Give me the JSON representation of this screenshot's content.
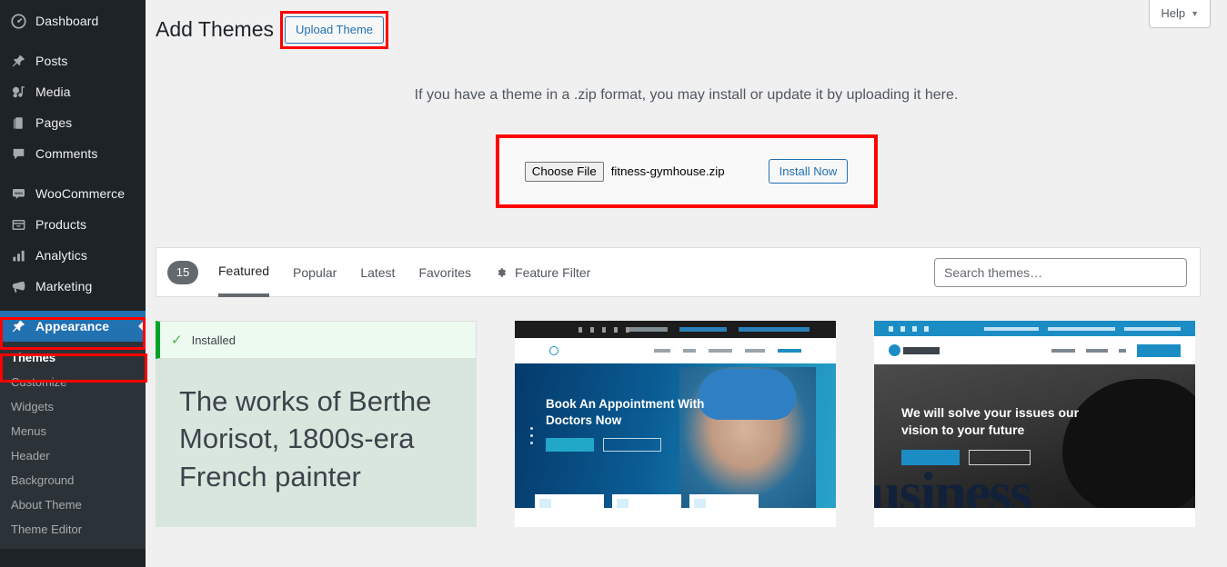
{
  "sidebar": {
    "items": [
      {
        "label": "Dashboard",
        "icon": "dashboard-icon"
      },
      {
        "label": "Posts",
        "icon": "pin-icon"
      },
      {
        "label": "Media",
        "icon": "media-icon"
      },
      {
        "label": "Pages",
        "icon": "pages-icon"
      },
      {
        "label": "Comments",
        "icon": "comments-icon"
      },
      {
        "label": "WooCommerce",
        "icon": "woocommerce-icon"
      },
      {
        "label": "Products",
        "icon": "products-icon"
      },
      {
        "label": "Analytics",
        "icon": "analytics-icon"
      },
      {
        "label": "Marketing",
        "icon": "megaphone-icon"
      },
      {
        "label": "Appearance",
        "icon": "appearance-icon"
      }
    ],
    "appearance_submenu": [
      "Themes",
      "Customize",
      "Widgets",
      "Menus",
      "Header",
      "Background",
      "About Theme",
      "Theme Editor"
    ],
    "current_item": "Appearance",
    "current_subitem": "Themes",
    "highlight_color": "#2271b1",
    "annotation_color": "#ff0000"
  },
  "header": {
    "help_label": "Help",
    "help_caret": "▼",
    "page_title": "Add Themes",
    "upload_theme_label": "Upload Theme"
  },
  "upload": {
    "description": "If you have a theme in a .zip format, you may install or update it by uploading it here.",
    "choose_file_label": "Choose File",
    "file_name": "fitness-gymhouse.zip",
    "install_now_label": "Install Now"
  },
  "filter_bar": {
    "count": "15",
    "tabs": [
      {
        "label": "Featured",
        "active": true
      },
      {
        "label": "Popular",
        "active": false
      },
      {
        "label": "Latest",
        "active": false
      },
      {
        "label": "Favorites",
        "active": false
      }
    ],
    "feature_filter_label": "Feature Filter",
    "feature_filter_icon": "gear-icon",
    "search_placeholder": "Search themes…"
  },
  "themes": [
    {
      "installed_label": "Installed",
      "preview_headline": "The works of Berthe Morisot, 1800s-era French painter"
    },
    {
      "preview_headline": "Book An Appointment With Doctors Now"
    },
    {
      "preview_headline": "We will solve your issues our vision to your future"
    }
  ]
}
